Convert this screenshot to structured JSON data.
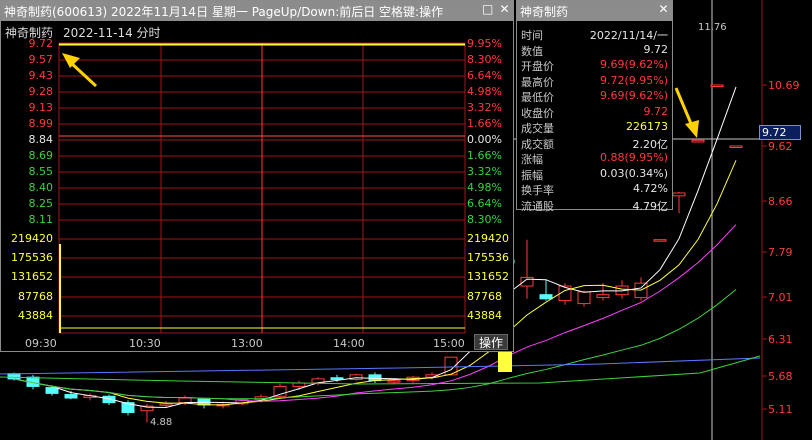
{
  "intraday_window": {
    "title": "神奇制药(600613)  2022年11月14日  星期一  PageUp/Down:前后日  空格键:操作",
    "restore_glyph": "□",
    "close_glyph": "✕",
    "chart_name": "神奇制药",
    "chart_date_label": "2022-11-14 分时",
    "price_labels": [
      "9.72",
      "9.57",
      "9.43",
      "9.28",
      "9.13",
      "8.99",
      "8.84",
      "8.69",
      "8.55",
      "8.40",
      "8.25",
      "8.11"
    ],
    "pct_labels": [
      "9.95%",
      "8.30%",
      "6.64%",
      "4.98%",
      "3.32%",
      "1.66%",
      "0.00%",
      "1.66%",
      "3.32%",
      "4.98%",
      "6.64%",
      "8.30%"
    ],
    "volume_labels": [
      "219420",
      "175536",
      "131652",
      "87768",
      "43884"
    ],
    "time_labels": [
      "09:30",
      "10:30",
      "13:00",
      "14:00",
      "15:00"
    ],
    "operate_button": "操作",
    "price_line_value": 9.72
  },
  "info_window": {
    "title": "神奇制药",
    "close_glyph": "✕",
    "rows": [
      {
        "key": "时间",
        "value": "2022/11/14/一",
        "color": "white"
      },
      {
        "key": "数值",
        "value": "9.72",
        "color": "white"
      },
      {
        "key": "开盘价",
        "value": "9.69(9.62%)",
        "color": "red"
      },
      {
        "key": "最高价",
        "value": "9.72(9.95%)",
        "color": "red"
      },
      {
        "key": "最低价",
        "value": "9.69(9.62%)",
        "color": "red"
      },
      {
        "key": "收盘价",
        "value": "9.72",
        "color": "red"
      },
      {
        "key": "成交量",
        "value": "226173",
        "color": "yellow"
      },
      {
        "key": "成交额",
        "value": "2.20亿",
        "color": "white"
      },
      {
        "key": "涨幅",
        "value": "0.88(9.95%)",
        "color": "red"
      },
      {
        "key": "振幅",
        "value": "0.03(0.34%)",
        "color": "white"
      },
      {
        "key": "换手率",
        "value": "4.72%",
        "color": "white"
      },
      {
        "key": "流通股",
        "value": "4.79亿",
        "color": "white"
      }
    ]
  },
  "kline": {
    "axis_labels": [
      "10.69",
      "9.62",
      "8.66",
      "7.79",
      "7.01",
      "6.31",
      "5.68",
      "5.11"
    ],
    "last_price_tag": "9.72",
    "top_marker": "11.76",
    "low_marker": "4.88",
    "colors": {
      "up": "#ff3b3b",
      "down": "#54ffff",
      "ma5": "#ffffff",
      "ma10": "#ffff3c",
      "ma20": "#ff40ff",
      "ma60": "#3bd43b",
      "ma120": "#5a78ff"
    }
  },
  "chart_data": {
    "type": "candlestick",
    "visible_price_axis": [
      10.69,
      9.62,
      8.66,
      7.79,
      7.01,
      6.31,
      5.68,
      5.11
    ],
    "last_close": 9.72,
    "period_high_marker": 11.76,
    "period_low_marker": 4.88,
    "candles": [
      {
        "o": 5.72,
        "h": 5.74,
        "l": 5.6,
        "c": 5.63
      },
      {
        "o": 5.66,
        "h": 5.7,
        "l": 5.45,
        "c": 5.5
      },
      {
        "o": 5.48,
        "h": 5.52,
        "l": 5.34,
        "c": 5.38
      },
      {
        "o": 5.36,
        "h": 5.42,
        "l": 5.28,
        "c": 5.3
      },
      {
        "o": 5.31,
        "h": 5.38,
        "l": 5.26,
        "c": 5.34
      },
      {
        "o": 5.33,
        "h": 5.36,
        "l": 5.18,
        "c": 5.22
      },
      {
        "o": 5.22,
        "h": 5.26,
        "l": 5.0,
        "c": 5.05
      },
      {
        "o": 5.08,
        "h": 5.2,
        "l": 4.88,
        "c": 5.16
      },
      {
        "o": 5.18,
        "h": 5.25,
        "l": 5.14,
        "c": 5.2
      },
      {
        "o": 5.22,
        "h": 5.34,
        "l": 5.18,
        "c": 5.3
      },
      {
        "o": 5.28,
        "h": 5.3,
        "l": 5.12,
        "c": 5.18
      },
      {
        "o": 5.18,
        "h": 5.24,
        "l": 5.12,
        "c": 5.19
      },
      {
        "o": 5.2,
        "h": 5.3,
        "l": 5.18,
        "c": 5.27
      },
      {
        "o": 5.27,
        "h": 5.36,
        "l": 5.22,
        "c": 5.32
      },
      {
        "o": 5.33,
        "h": 5.55,
        "l": 5.3,
        "c": 5.5
      },
      {
        "o": 5.5,
        "h": 5.6,
        "l": 5.44,
        "c": 5.56
      },
      {
        "o": 5.56,
        "h": 5.66,
        "l": 5.52,
        "c": 5.63
      },
      {
        "o": 5.65,
        "h": 5.7,
        "l": 5.58,
        "c": 5.62
      },
      {
        "o": 5.62,
        "h": 5.72,
        "l": 5.6,
        "c": 5.7
      },
      {
        "o": 5.7,
        "h": 5.74,
        "l": 5.56,
        "c": 5.6
      },
      {
        "o": 5.58,
        "h": 5.64,
        "l": 5.54,
        "c": 5.6
      },
      {
        "o": 5.6,
        "h": 5.68,
        "l": 5.56,
        "c": 5.66
      },
      {
        "o": 5.66,
        "h": 5.74,
        "l": 5.62,
        "c": 5.7
      },
      {
        "o": 5.7,
        "h": 6.0,
        "l": 5.7,
        "c": 6.0
      },
      {
        "o": 6.6,
        "h": 6.6,
        "l": 6.6,
        "c": 6.6
      },
      {
        "o": 7.01,
        "h": 7.01,
        "l": 7.01,
        "c": 7.01
      },
      {
        "o": 7.65,
        "h": 7.72,
        "l": 7.58,
        "c": 7.6
      },
      {
        "o": 7.2,
        "h": 8.0,
        "l": 6.98,
        "c": 7.35
      },
      {
        "o": 7.05,
        "h": 7.3,
        "l": 6.95,
        "c": 6.98
      },
      {
        "o": 6.95,
        "h": 7.25,
        "l": 6.88,
        "c": 7.2
      },
      {
        "o": 6.9,
        "h": 7.12,
        "l": 6.85,
        "c": 7.1
      },
      {
        "o": 7.0,
        "h": 7.25,
        "l": 6.95,
        "c": 7.05
      },
      {
        "o": 7.05,
        "h": 7.3,
        "l": 6.98,
        "c": 7.2
      },
      {
        "o": 7.0,
        "h": 7.35,
        "l": 6.95,
        "c": 7.25
      },
      {
        "o": 8.0,
        "h": 8.0,
        "l": 8.0,
        "c": 8.0
      },
      {
        "o": 8.75,
        "h": 8.82,
        "l": 8.45,
        "c": 8.8
      },
      {
        "o": 9.69,
        "h": 9.72,
        "l": 9.69,
        "c": 9.72
      },
      {
        "o": 10.69,
        "h": 10.69,
        "l": 10.69,
        "c": 10.69
      },
      {
        "o": 11.76,
        "h": 11.76,
        "l": 11.76,
        "c": 11.76
      }
    ]
  }
}
